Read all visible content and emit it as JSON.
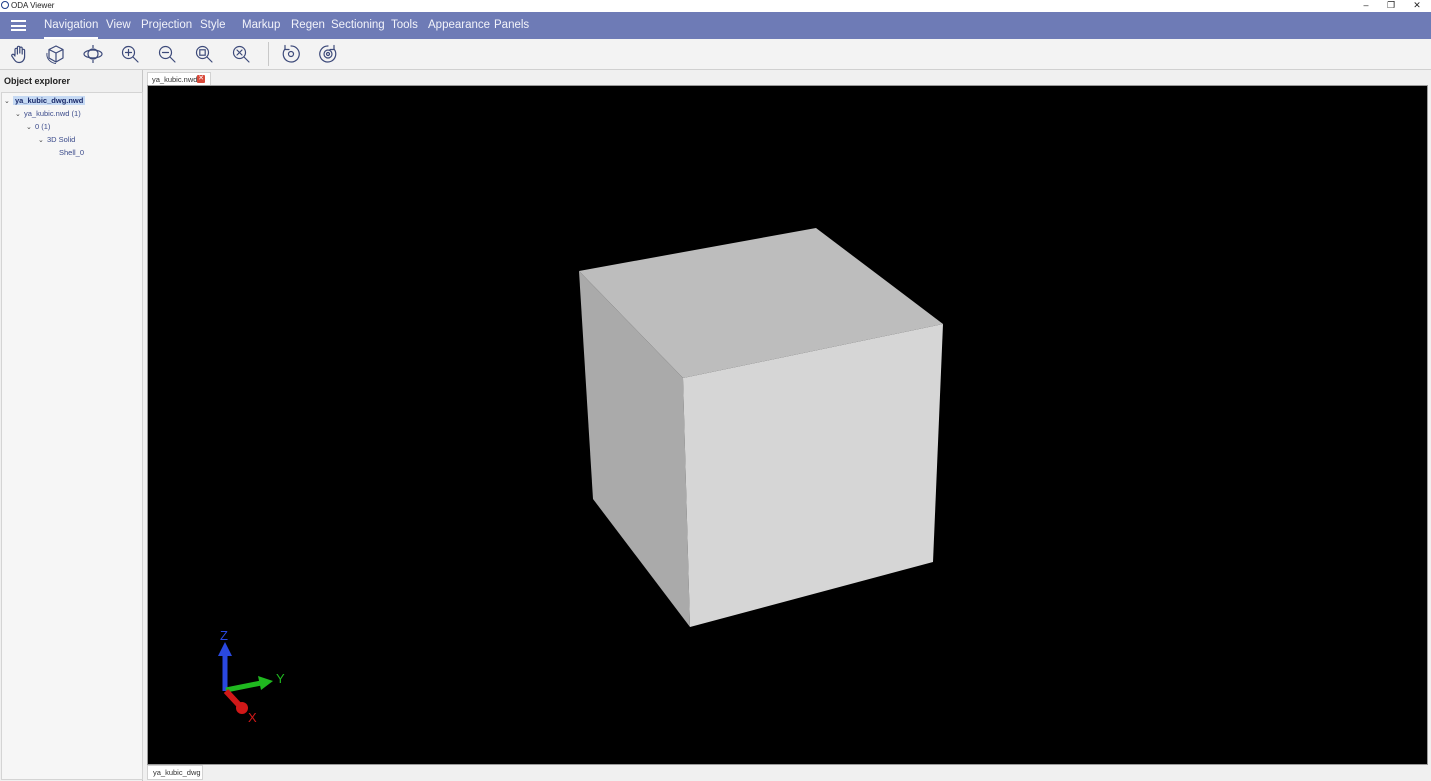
{
  "window": {
    "title": "ODA Viewer",
    "minimize": "–",
    "restore": "❐",
    "close": "✕"
  },
  "menu": {
    "items": [
      "Navigation",
      "View",
      "Projection",
      "Style",
      "Markup",
      "Regen",
      "Sectioning",
      "Tools",
      "Appearance",
      "Panels"
    ],
    "active": "Navigation"
  },
  "toolbar": {
    "tools": [
      "pan-icon",
      "orbit-box-icon",
      "orbit-icon",
      "zoom-in-icon",
      "zoom-out-icon",
      "zoom-window-icon",
      "zoom-extents-icon",
      "undo-view-icon",
      "redo-view-icon"
    ]
  },
  "explorer": {
    "title": "Object explorer",
    "tree": [
      {
        "label": "ya_kubic_dwg.nwd",
        "level": 0,
        "expanded": true,
        "selected": true
      },
      {
        "label": "ya_kubic.nwd (1)",
        "level": 1,
        "expanded": true,
        "selected": false
      },
      {
        "label": "0 (1)",
        "level": 2,
        "expanded": true,
        "selected": false
      },
      {
        "label": "3D Solid",
        "level": 3,
        "expanded": true,
        "selected": false
      },
      {
        "label": "Shell_0",
        "level": 4,
        "expanded": false,
        "selected": false
      }
    ]
  },
  "document_tab": {
    "label": "ya_kubic.nwd"
  },
  "layout_tab": {
    "label": "ya_kubic_dwg"
  },
  "axes": {
    "z_label": "Z",
    "y_label": "Y",
    "x_label": "X",
    "z_color": "#2a48e0",
    "y_color": "#1fb81f",
    "x_color": "#d01818"
  },
  "cube": {
    "top_color": "#bdbdbd",
    "left_color": "#aaaaaa",
    "front_color": "#d6d6d6"
  },
  "colors": {
    "menubar": "#6e7bb6",
    "viewport_bg": "#000000"
  }
}
